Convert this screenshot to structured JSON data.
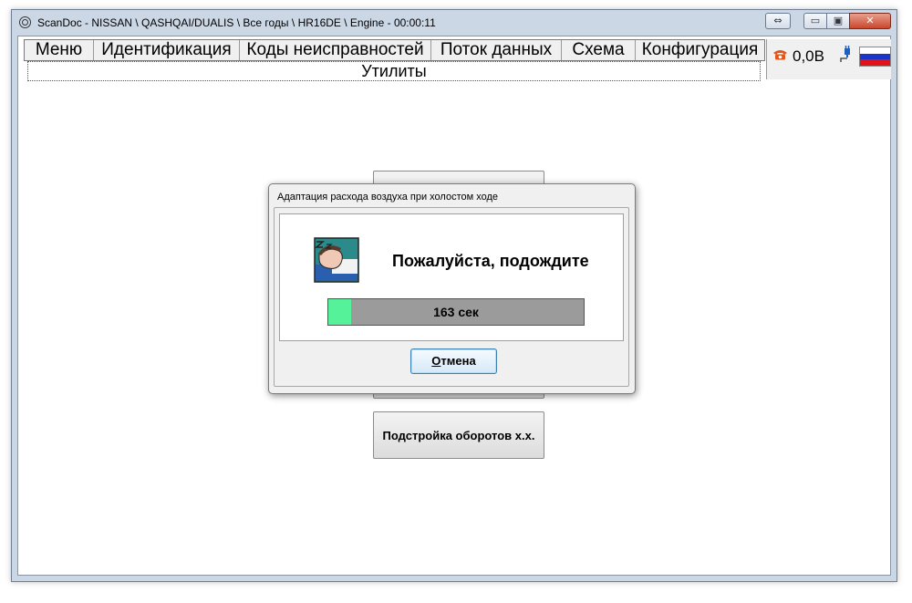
{
  "window": {
    "title": "ScanDoc - NISSAN \\ QASHQAI/DUALIS \\ Все годы \\ HR16DE \\ Engine - 00:00:11",
    "restore_glyph": "⇔",
    "minimize_glyph": "▭",
    "maximize_glyph": "▣",
    "close_glyph": "✕"
  },
  "menu": {
    "items": [
      {
        "label": "Меню"
      },
      {
        "label": "Идентификация"
      },
      {
        "label": "Коды неисправностей"
      },
      {
        "label": "Поток данных"
      },
      {
        "label": "Схема"
      },
      {
        "label": "Конфигурация"
      }
    ],
    "active_tab": "Утилиты"
  },
  "status": {
    "phone_icon": "phone-icon",
    "voltage": "0,0В",
    "plug_icon": "plug-icon",
    "flag_icon": "russian-flag-icon",
    "colors": {
      "phone": "#e0561a",
      "flag_white": "#ffffff",
      "flag_blue": "#1b36c9",
      "flag_red": "#e2121b"
    }
  },
  "background_buttons": {
    "button_3": "Подстройка оборотов х.х."
  },
  "dialog": {
    "title": "Адаптация расхода воздуха при холостом ходе",
    "message": "Пожалуйста, подождите",
    "progress_text": "163 сек",
    "progress_fraction": 0.09,
    "cancel_first_letter": "О",
    "cancel_rest": "тмена",
    "icon": "sleeping-person-icon",
    "colors": {
      "progress_fill": "#55f29a",
      "progress_bg": "#9b9b9b"
    }
  }
}
